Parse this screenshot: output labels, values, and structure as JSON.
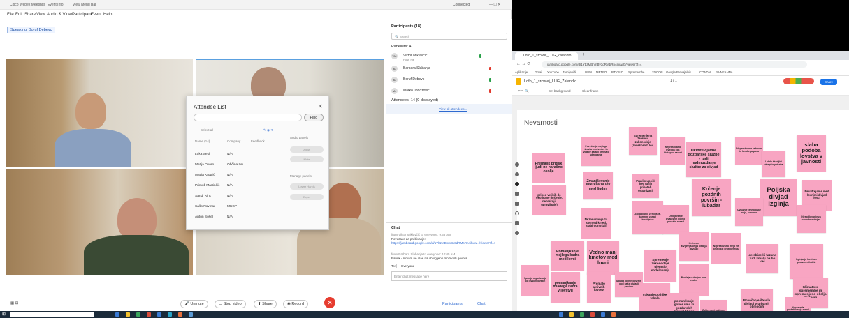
{
  "webex": {
    "title_left": "Cisco Webex Meetings",
    "title_tab2": "Event Info",
    "title_tab3": "View Menu Bar",
    "connected": "Connected",
    "menu": [
      "File",
      "Edit",
      "Share",
      "View",
      "Audio & Video",
      "Participant",
      "Event",
      "Help"
    ],
    "speaking_label": "Speaking:",
    "speaking_name": "Boruf Debevc",
    "controls": {
      "unmute": "Unmute",
      "stop_video": "Stop video",
      "share": "Share",
      "record": "Record",
      "more": "···",
      "end": "✕"
    },
    "side_bottom": {
      "participants": "Participants",
      "chat": "Chat"
    }
  },
  "attendee_list": {
    "title": "Attendee List",
    "find_button": "Find",
    "select_all": "Select all",
    "columns": [
      "Name (14)",
      "Company",
      "Feedback"
    ],
    "rows": [
      {
        "name": "Luka Sesl",
        "company": "N/A"
      },
      {
        "name": "Matija Okorn",
        "company": "Občina Ivu..."
      },
      {
        "name": "Matija Kruplič",
        "company": "N/A"
      },
      {
        "name": "Primož Martinčič",
        "company": "N/A"
      },
      {
        "name": "Sandi Rinc",
        "company": "N/A"
      },
      {
        "name": "Sašo Novinar",
        "company": "MKGP"
      },
      {
        "name": "Anton Sošel",
        "company": "N/A"
      }
    ],
    "audio_panel": "Audio panels",
    "manage_panel": "Manage panels",
    "buttons": [
      "Allow",
      "Mute",
      "Lower Hands",
      "Expel"
    ]
  },
  "participants": {
    "header": "Participants (18)",
    "search_placeholder": "Search",
    "panelists_header": "Panelists: 4",
    "panelists": [
      {
        "initials": "VM",
        "name": "Viktor Miklavčič",
        "sub": "Host, me"
      },
      {
        "initials": "BD",
        "name": "Barbara Slabanja"
      },
      {
        "initials": "BD",
        "name": "Boruf Debevc"
      },
      {
        "initials": "MJ",
        "name": "Marko Jonozovič"
      }
    ],
    "attendees_header": "Attendees: 14 (0 displayed)",
    "view_all": "View all attendees..."
  },
  "chat": {
    "header": "Chat",
    "line1": "from Viktor Miklavčič to everyone:  9:58 AM",
    "line2": "Povezave za prebivanje:",
    "link": "https://jamboard.google.com/d/1YbzMBnmBv3dRMbRn4ihuw.../viewer?f=4",
    "line3": "from Barbara Slabanja to everyone:  10:05 AM",
    "line4": "Babrik - nimam ne alae na oblogijeno možnosti govora",
    "to_label": "To:",
    "to_value": "Everyone",
    "input_placeholder": "Enter chat message here"
  },
  "browser": {
    "tab_title": "Lofo_1_srcwlej_LUG_Zalandlo",
    "url": "jamboard.google.com/d/1YbzMBnmBv3dRMbRn4ihuwG/viewer?f=4",
    "bookmarks": [
      "Aplikacije",
      "Gmail",
      "YouTube",
      "Zemljevidi",
      "ISRN",
      "METEO",
      "RTVSLO",
      "Spremembe",
      "ZOCON",
      "Google Prevajalnik",
      "CONDIA",
      "SVNEANNA"
    ],
    "jam_title": "Lofo_1_srcwlej_LUG_Zalandlo",
    "page_indicator": "1 / 1",
    "share_button": "Share",
    "tools": [
      "Set background",
      "Clear frame"
    ],
    "board_title": "Nevarnosti"
  },
  "notes": [
    "Premalik pritisk ljudi ne narašno okolje",
    "Povečanje mejlega števila medvedov in volkov zaradi premalo ukrepanja",
    "Spremenjena žerebov zakonodaje (zaveščenih lov.",
    "Neprestivano Izvedba ogr. biotopov zaradi",
    "Ukinitev javne gozdarske službe - tudi nadmuzdanje službe za divjad",
    "Neprestivana zahteva in lovskega pasu",
    "Lokdu škodljivi ukrepi in potreba",
    "slaba podoba lovstva v javnosti",
    "Zmanjševanje interesa za lov med ljudmi",
    "Pravilo upošk hec tanih prisoteb organizacij",
    "Krčenje gozdnih površin - lubadar",
    "Poljska divjad izginja",
    "Neuvtrejanje med lovnimi divjad lovci",
    "prihod velikih do okolicane (krčenje, nebreknji, upravljanje)",
    "Nezanimanje za lov med kmeti, slabi odnošaji",
    "Zlorabljanje zemljišča, kamnin, zaradi kmetijstva",
    "Uvajanje tehnološke nuje, zunanje",
    "Omejevanje izvajaščih poljski površin nasad",
    "Nesodlovanje za obvodnje divjad",
    "Vedno manj kmetov med lovci",
    "Pomanjkanje mejlega kadra med lovci",
    "Krčenje življenjskega okolja divjadi",
    "Neprestivano meja vir kmetijski proti krčenju",
    "Spremenje zakonodaje ujemajo sodelovanja",
    "Prodaja v dvojno pom vodne",
    "pomanjkanje mladega kadra v lovstvu",
    "Premalo aktivnih lovcev",
    "Izguba lovnih površin pod naše divjadi prisilno",
    "Sprenja organizacija od lovskih lovskih",
    "Izginjanje lovstva v posameznih dela",
    "Jerebice ki fazana tudi kmalu ne bo več",
    "vtikanje politike tekala",
    "pomanjkanje govor umi, ki gozdarskih (veljaj) škode",
    "Zahtevnost poklicev za zaposlitev",
    "Povečanje števila divjadi v urbanih območjih",
    "Klimatske spremembe in spremenjeno okolja za živali",
    "Neposreda poskrbovanje zaradi dvojnega obvezanje"
  ]
}
